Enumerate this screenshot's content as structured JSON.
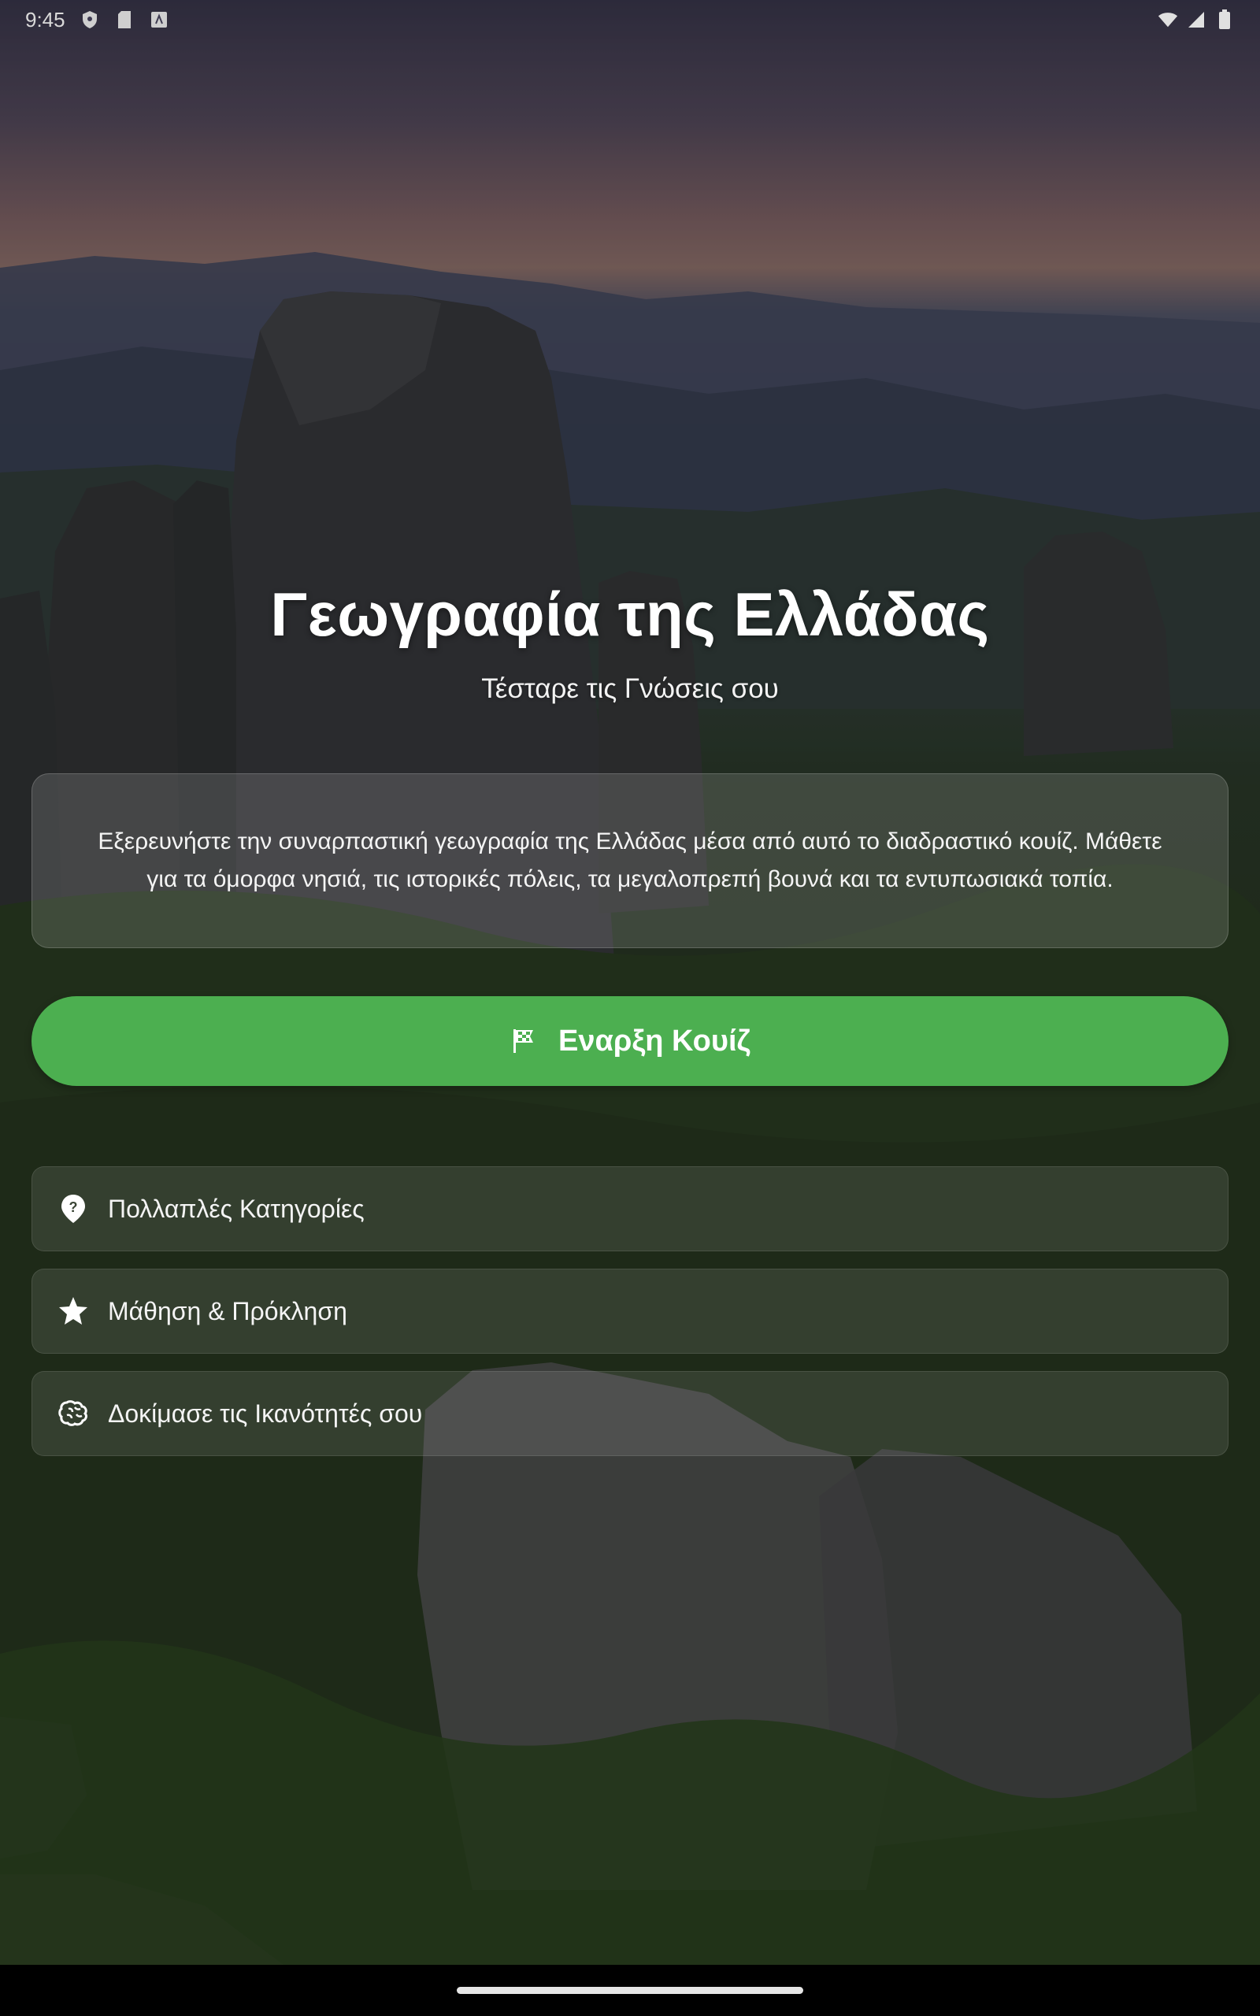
{
  "status_bar": {
    "time": "9:45",
    "left_icons": [
      "shield-icon",
      "sd-card-icon",
      "keyboard-icon"
    ],
    "right_icons": [
      "wifi-icon",
      "cellular-signal-icon",
      "battery-icon"
    ]
  },
  "main": {
    "title": "Γεωγραφία της Ελλάδας",
    "subtitle": "Τέσταρε τις Γνώσεις σου",
    "description": "Εξερευνήστε την συναρπαστική γεωγραφία της Ελλάδας μέσα από αυτό το διαδραστικό κουίζ. Μάθετε για τα όμορφα νησιά, τις ιστορικές πόλεις, τα μεγαλοπρεπή βουνά και τα εντυπωσιακά τοπία.",
    "start_button": {
      "label": "Εναρξη Κουίζ",
      "icon": "checkered-flag-icon",
      "color": "#4caf50"
    },
    "features": [
      {
        "label": "Πολλαπλές Κατηγορίες",
        "icon": "location-help-icon"
      },
      {
        "label": "Μάθηση & Πρόκληση",
        "icon": "star-icon"
      },
      {
        "label": "Δοκίμασε τις Ικανότητές σου",
        "icon": "brain-icon"
      }
    ]
  },
  "background": {
    "description_icon": "mountain-landscape-image"
  }
}
